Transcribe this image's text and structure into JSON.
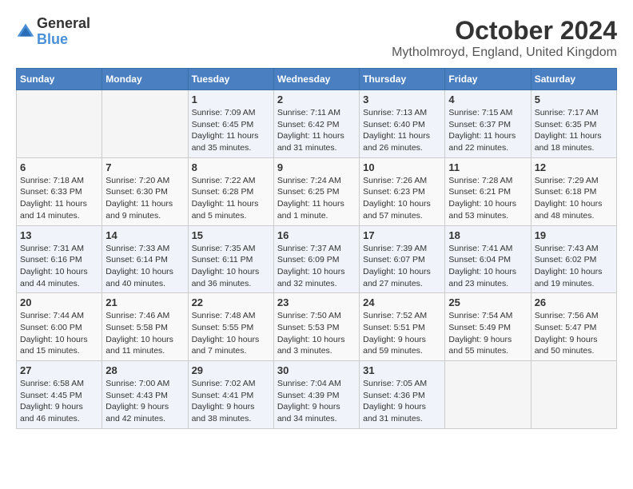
{
  "header": {
    "logo_line1": "General",
    "logo_line2": "Blue",
    "month_title": "October 2024",
    "location": "Mytholmroyd, England, United Kingdom"
  },
  "days_of_week": [
    "Sunday",
    "Monday",
    "Tuesday",
    "Wednesday",
    "Thursday",
    "Friday",
    "Saturday"
  ],
  "weeks": [
    [
      {
        "day": "",
        "empty": true
      },
      {
        "day": "",
        "empty": true
      },
      {
        "day": "1",
        "sunrise": "Sunrise: 7:09 AM",
        "sunset": "Sunset: 6:45 PM",
        "daylight": "Daylight: 11 hours and 35 minutes."
      },
      {
        "day": "2",
        "sunrise": "Sunrise: 7:11 AM",
        "sunset": "Sunset: 6:42 PM",
        "daylight": "Daylight: 11 hours and 31 minutes."
      },
      {
        "day": "3",
        "sunrise": "Sunrise: 7:13 AM",
        "sunset": "Sunset: 6:40 PM",
        "daylight": "Daylight: 11 hours and 26 minutes."
      },
      {
        "day": "4",
        "sunrise": "Sunrise: 7:15 AM",
        "sunset": "Sunset: 6:37 PM",
        "daylight": "Daylight: 11 hours and 22 minutes."
      },
      {
        "day": "5",
        "sunrise": "Sunrise: 7:17 AM",
        "sunset": "Sunset: 6:35 PM",
        "daylight": "Daylight: 11 hours and 18 minutes."
      }
    ],
    [
      {
        "day": "6",
        "sunrise": "Sunrise: 7:18 AM",
        "sunset": "Sunset: 6:33 PM",
        "daylight": "Daylight: 11 hours and 14 minutes."
      },
      {
        "day": "7",
        "sunrise": "Sunrise: 7:20 AM",
        "sunset": "Sunset: 6:30 PM",
        "daylight": "Daylight: 11 hours and 9 minutes."
      },
      {
        "day": "8",
        "sunrise": "Sunrise: 7:22 AM",
        "sunset": "Sunset: 6:28 PM",
        "daylight": "Daylight: 11 hours and 5 minutes."
      },
      {
        "day": "9",
        "sunrise": "Sunrise: 7:24 AM",
        "sunset": "Sunset: 6:25 PM",
        "daylight": "Daylight: 11 hours and 1 minute."
      },
      {
        "day": "10",
        "sunrise": "Sunrise: 7:26 AM",
        "sunset": "Sunset: 6:23 PM",
        "daylight": "Daylight: 10 hours and 57 minutes."
      },
      {
        "day": "11",
        "sunrise": "Sunrise: 7:28 AM",
        "sunset": "Sunset: 6:21 PM",
        "daylight": "Daylight: 10 hours and 53 minutes."
      },
      {
        "day": "12",
        "sunrise": "Sunrise: 7:29 AM",
        "sunset": "Sunset: 6:18 PM",
        "daylight": "Daylight: 10 hours and 48 minutes."
      }
    ],
    [
      {
        "day": "13",
        "sunrise": "Sunrise: 7:31 AM",
        "sunset": "Sunset: 6:16 PM",
        "daylight": "Daylight: 10 hours and 44 minutes."
      },
      {
        "day": "14",
        "sunrise": "Sunrise: 7:33 AM",
        "sunset": "Sunset: 6:14 PM",
        "daylight": "Daylight: 10 hours and 40 minutes."
      },
      {
        "day": "15",
        "sunrise": "Sunrise: 7:35 AM",
        "sunset": "Sunset: 6:11 PM",
        "daylight": "Daylight: 10 hours and 36 minutes."
      },
      {
        "day": "16",
        "sunrise": "Sunrise: 7:37 AM",
        "sunset": "Sunset: 6:09 PM",
        "daylight": "Daylight: 10 hours and 32 minutes."
      },
      {
        "day": "17",
        "sunrise": "Sunrise: 7:39 AM",
        "sunset": "Sunset: 6:07 PM",
        "daylight": "Daylight: 10 hours and 27 minutes."
      },
      {
        "day": "18",
        "sunrise": "Sunrise: 7:41 AM",
        "sunset": "Sunset: 6:04 PM",
        "daylight": "Daylight: 10 hours and 23 minutes."
      },
      {
        "day": "19",
        "sunrise": "Sunrise: 7:43 AM",
        "sunset": "Sunset: 6:02 PM",
        "daylight": "Daylight: 10 hours and 19 minutes."
      }
    ],
    [
      {
        "day": "20",
        "sunrise": "Sunrise: 7:44 AM",
        "sunset": "Sunset: 6:00 PM",
        "daylight": "Daylight: 10 hours and 15 minutes."
      },
      {
        "day": "21",
        "sunrise": "Sunrise: 7:46 AM",
        "sunset": "Sunset: 5:58 PM",
        "daylight": "Daylight: 10 hours and 11 minutes."
      },
      {
        "day": "22",
        "sunrise": "Sunrise: 7:48 AM",
        "sunset": "Sunset: 5:55 PM",
        "daylight": "Daylight: 10 hours and 7 minutes."
      },
      {
        "day": "23",
        "sunrise": "Sunrise: 7:50 AM",
        "sunset": "Sunset: 5:53 PM",
        "daylight": "Daylight: 10 hours and 3 minutes."
      },
      {
        "day": "24",
        "sunrise": "Sunrise: 7:52 AM",
        "sunset": "Sunset: 5:51 PM",
        "daylight": "Daylight: 9 hours and 59 minutes."
      },
      {
        "day": "25",
        "sunrise": "Sunrise: 7:54 AM",
        "sunset": "Sunset: 5:49 PM",
        "daylight": "Daylight: 9 hours and 55 minutes."
      },
      {
        "day": "26",
        "sunrise": "Sunrise: 7:56 AM",
        "sunset": "Sunset: 5:47 PM",
        "daylight": "Daylight: 9 hours and 50 minutes."
      }
    ],
    [
      {
        "day": "27",
        "sunrise": "Sunrise: 6:58 AM",
        "sunset": "Sunset: 4:45 PM",
        "daylight": "Daylight: 9 hours and 46 minutes."
      },
      {
        "day": "28",
        "sunrise": "Sunrise: 7:00 AM",
        "sunset": "Sunset: 4:43 PM",
        "daylight": "Daylight: 9 hours and 42 minutes."
      },
      {
        "day": "29",
        "sunrise": "Sunrise: 7:02 AM",
        "sunset": "Sunset: 4:41 PM",
        "daylight": "Daylight: 9 hours and 38 minutes."
      },
      {
        "day": "30",
        "sunrise": "Sunrise: 7:04 AM",
        "sunset": "Sunset: 4:39 PM",
        "daylight": "Daylight: 9 hours and 34 minutes."
      },
      {
        "day": "31",
        "sunrise": "Sunrise: 7:05 AM",
        "sunset": "Sunset: 4:36 PM",
        "daylight": "Daylight: 9 hours and 31 minutes."
      },
      {
        "day": "",
        "empty": true
      },
      {
        "day": "",
        "empty": true
      }
    ]
  ]
}
